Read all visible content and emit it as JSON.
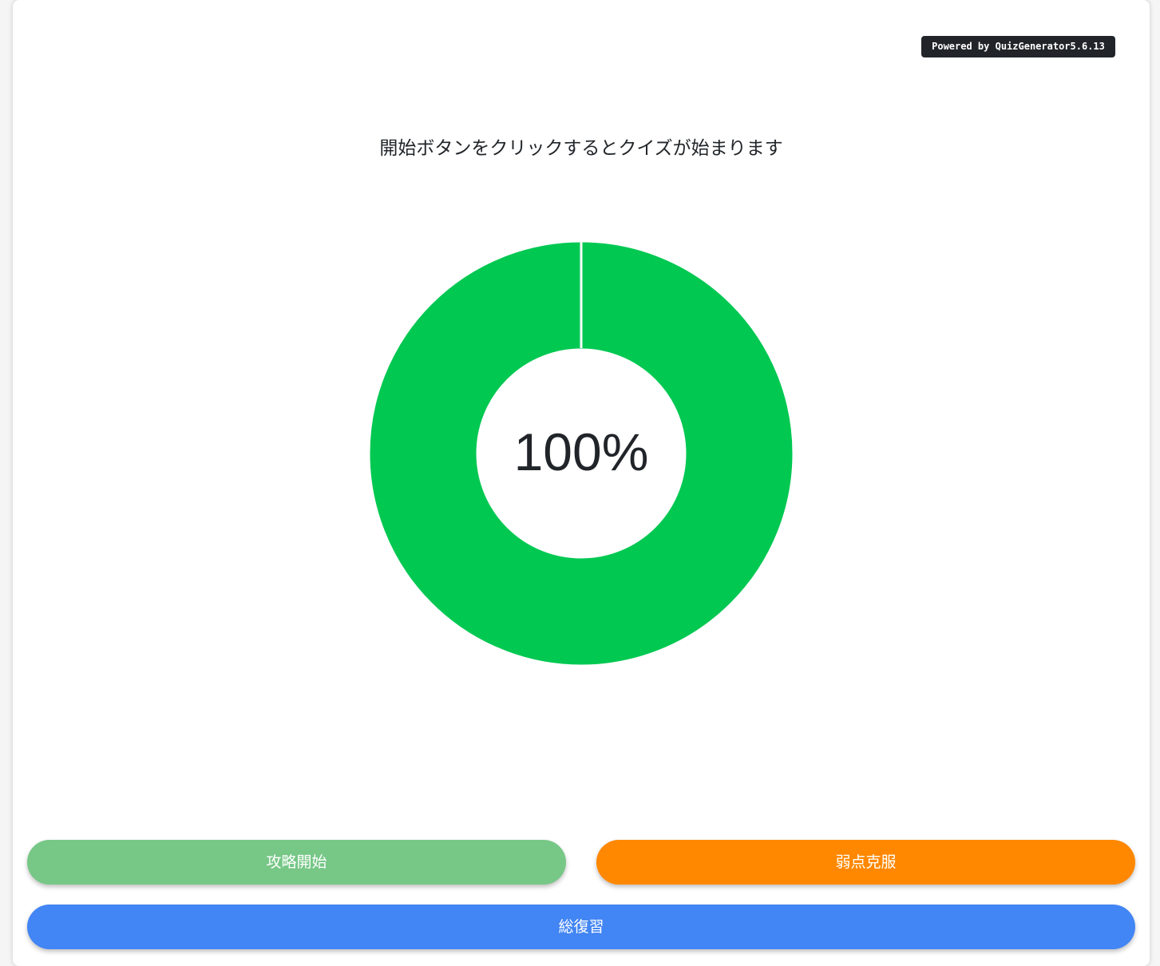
{
  "badge": {
    "powered_label": "Powered by QuizGenerator5.6.13"
  },
  "instruction": {
    "text": "開始ボタンをクリックするとクイズが始まります"
  },
  "progress": {
    "percent_label": "100%",
    "value": 1.0,
    "color": "#00c851"
  },
  "buttons": {
    "start": {
      "label": "攻略開始",
      "color": "#77c787"
    },
    "weak": {
      "label": "弱点克服",
      "color": "#ff8800"
    },
    "review": {
      "label": "総復習",
      "color": "#4285f4"
    }
  }
}
